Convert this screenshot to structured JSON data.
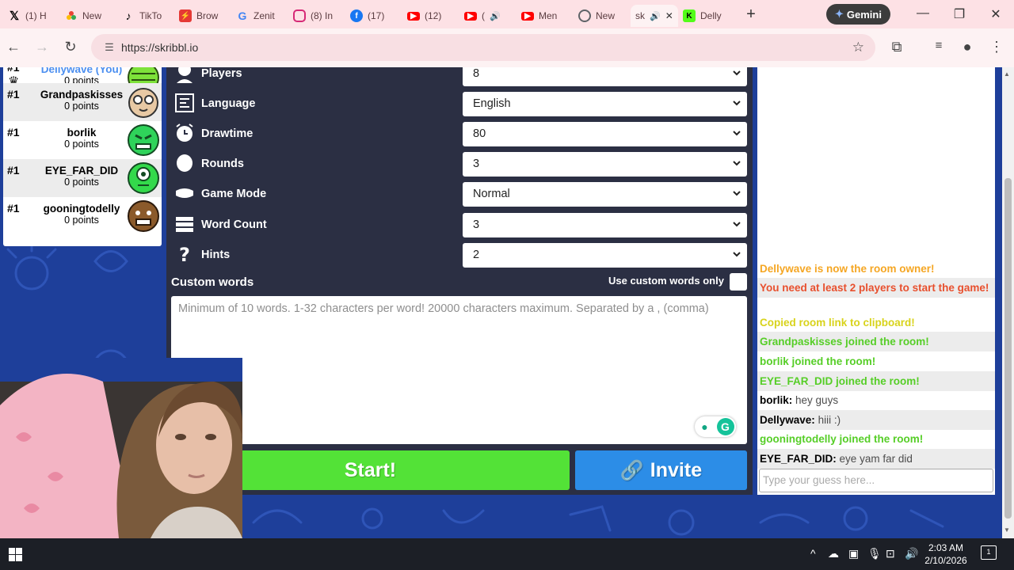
{
  "browser": {
    "tabs": [
      {
        "label": "(1) H",
        "icon": "x-icon",
        "color": "#000000"
      },
      {
        "label": "New",
        "icon": "photos-icon",
        "color": "#ea4335"
      },
      {
        "label": "TikTo",
        "icon": "tiktok-icon",
        "color": "#000000"
      },
      {
        "label": "Brow",
        "icon": "bolt-icon",
        "color": "#e53935"
      },
      {
        "label": "Zenit",
        "icon": "google-icon",
        "color": "#4285f4"
      },
      {
        "label": "(8) In",
        "icon": "instagram-icon",
        "color": "#d62976"
      },
      {
        "label": "(17)",
        "icon": "facebook-icon",
        "color": "#1877f2"
      },
      {
        "label": "(12)",
        "icon": "youtube-icon",
        "color": "#ff0000"
      },
      {
        "label": "(",
        "icon": "youtube-icon",
        "color": "#ff0000"
      },
      {
        "label": "Men",
        "icon": "youtube-icon",
        "color": "#ff0000"
      },
      {
        "label": "New",
        "icon": "chrome-icon",
        "color": "#5f6368"
      },
      {
        "label": "sk",
        "icon": "skribbl-icon",
        "color": "#1e3f9a"
      },
      {
        "label": "Delly",
        "icon": "kick-icon",
        "color": "#53fc18"
      }
    ],
    "new_tab": "+",
    "gemini_label": "Gemini",
    "url": "https://skribbl.io"
  },
  "players": [
    {
      "rank": "#1",
      "name": "Dellywave (You)",
      "points": "0 points",
      "is_you": true,
      "owner": true,
      "avatar_color": "#7ee23a"
    },
    {
      "rank": "#1",
      "name": "Grandpaskisses",
      "points": "0 points",
      "is_you": false,
      "owner": false,
      "avatar_color": "#e8c9a4"
    },
    {
      "rank": "#1",
      "name": "borlik",
      "points": "0 points",
      "is_you": false,
      "owner": false,
      "avatar_color": "#2fd35a"
    },
    {
      "rank": "#1",
      "name": "EYE_FAR_DID",
      "points": "0 points",
      "is_you": false,
      "owner": false,
      "avatar_color": "#33d94b"
    },
    {
      "rank": "#1",
      "name": "gooningtodelly",
      "points": "0 points",
      "is_you": false,
      "owner": false,
      "avatar_color": "#8b5a2b"
    }
  ],
  "settings": {
    "rows": [
      {
        "label": "Players",
        "value": "8",
        "icon": "player-icon"
      },
      {
        "label": "Language",
        "value": "English",
        "icon": "language-icon"
      },
      {
        "label": "Drawtime",
        "value": "80",
        "icon": "alarm-clock-icon"
      },
      {
        "label": "Rounds",
        "value": "3",
        "icon": "rounds-icon"
      },
      {
        "label": "Game Mode",
        "value": "Normal",
        "icon": "gamemode-icon"
      },
      {
        "label": "Word Count",
        "value": "3",
        "icon": "wordcount-icon"
      },
      {
        "label": "Hints",
        "value": "2",
        "icon": "hint-icon"
      }
    ],
    "custom_words_title": "Custom words",
    "use_custom_label": "Use custom words only",
    "custom_words_placeholder": "Minimum of 10 words. 1-32 characters per word! 20000 characters maximum. Separated by a , (comma)",
    "start_label": "Start!",
    "invite_label": "Invite"
  },
  "chat": {
    "messages": [
      {
        "who": "",
        "text": "Dellywave is now the room owner!",
        "color": "#f5a623"
      },
      {
        "who": "",
        "text": "You need at least 2 players to start the game!",
        "color": "#e8502e"
      },
      {
        "who": "",
        "text": "Copied room link to clipboard!",
        "color": "#d8d31b"
      },
      {
        "who": "",
        "text": "Grandpaskisses joined the room!",
        "color": "#56ce27"
      },
      {
        "who": "",
        "text": "borlik joined the room!",
        "color": "#56ce27"
      },
      {
        "who": "",
        "text": "EYE_FAR_DID joined the room!",
        "color": "#56ce27"
      },
      {
        "who": "borlik:",
        "text": "hey guys",
        "color": "#000000"
      },
      {
        "who": "Dellywave:",
        "text": "hiii :)",
        "color": "#000000"
      },
      {
        "who": "",
        "text": "gooningtodelly joined the room!",
        "color": "#56ce27"
      },
      {
        "who": "EYE_FAR_DID:",
        "text": "eye yam far did",
        "color": "#000000"
      }
    ],
    "guess_placeholder": "Type your guess here..."
  },
  "taskbar": {
    "time": "2:03 AM",
    "date": "2/10/2026",
    "notifications": "1"
  }
}
